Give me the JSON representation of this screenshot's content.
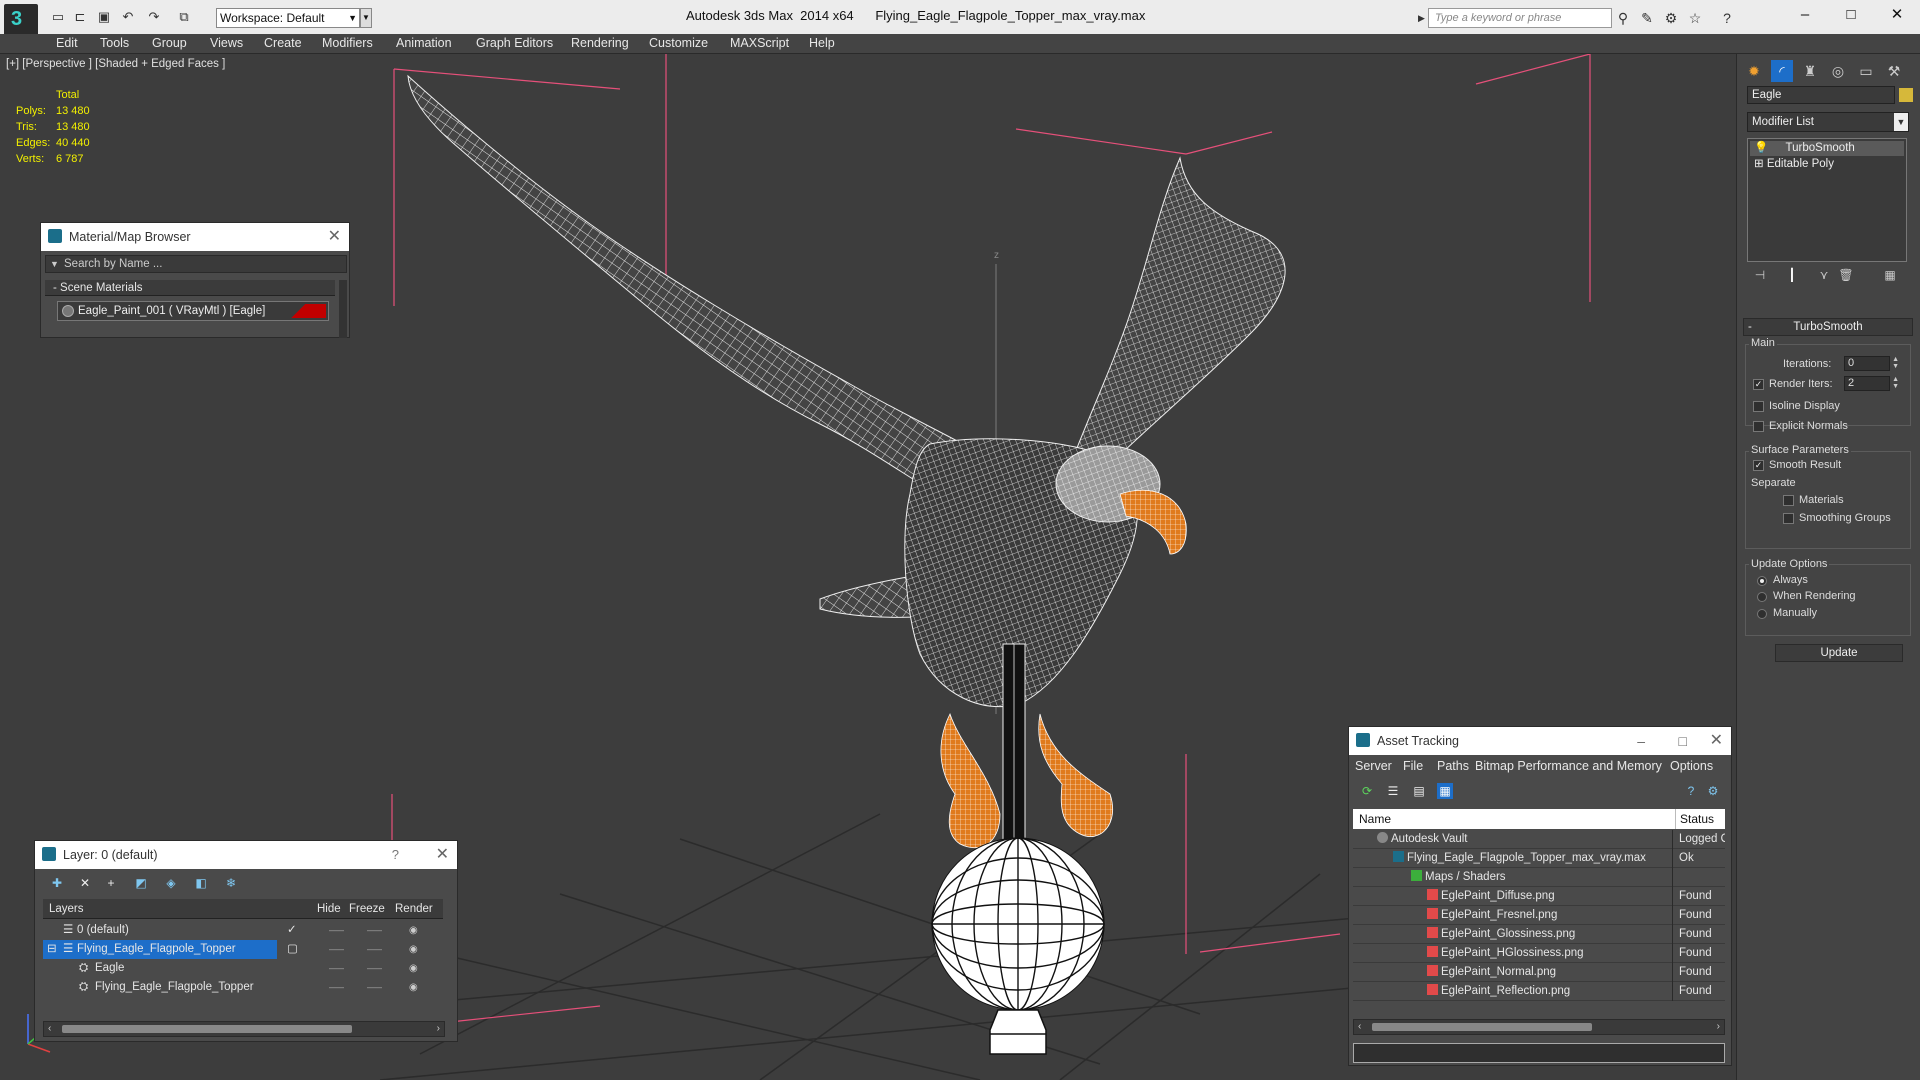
{
  "titlebar": {
    "workspace_label": "Workspace: Default",
    "app_title": "Autodesk 3ds Max  2014 x64",
    "file_title": "Flying_Eagle_Flagpole_Topper_max_vray.max",
    "search_placeholder": "Type a keyword or phrase"
  },
  "menubar": [
    "Edit",
    "Tools",
    "Group",
    "Views",
    "Create",
    "Modifiers",
    "Animation",
    "Graph Editors",
    "Rendering",
    "Customize",
    "MAXScript",
    "Help"
  ],
  "viewport": {
    "label": "[+] [Perspective ] [Shaded + Edged Faces ]",
    "stats": {
      "header": "Total",
      "rows": [
        {
          "label": "Polys:",
          "value": "13 480"
        },
        {
          "label": "Tris:",
          "value": "13 480"
        },
        {
          "label": "Edges:",
          "value": "40 440"
        },
        {
          "label": "Verts:",
          "value": "6 787"
        }
      ]
    },
    "axis_z": "z"
  },
  "material_browser": {
    "title": "Material/Map Browser",
    "search_placeholder": "Search by Name ...",
    "section": "Scene Materials",
    "section_toggle": "-",
    "item": "Eagle_Paint_001  ( VRayMtl )  [Eagle]",
    "accent": "#c10000"
  },
  "layer_panel": {
    "title": "Layer: 0 (default)",
    "help": "?",
    "columns": [
      "Layers",
      "Hide",
      "Freeze",
      "Render"
    ],
    "rows": [
      {
        "name": "0 (default)",
        "selected": false
      },
      {
        "name": "Flying_Eagle_Flagpole_Topper",
        "selected": true
      },
      {
        "name": "Eagle",
        "selected": false
      },
      {
        "name": "Flying_Eagle_Flagpole_Topper",
        "selected": false
      }
    ],
    "selection_color": "#1d6ec9"
  },
  "asset_tracking": {
    "title": "Asset Tracking",
    "menu": [
      "Server",
      "File",
      "Paths",
      "Bitmap Performance and Memory",
      "Options"
    ],
    "columns": [
      "Name",
      "Status"
    ],
    "rows": [
      {
        "name": "Autodesk Vault",
        "status": "Logged O",
        "indent": 1,
        "icon": "vault-icon"
      },
      {
        "name": "Flying_Eagle_Flagpole_Topper_max_vray.max",
        "status": "Ok",
        "indent": 2,
        "icon": "max-file-icon"
      },
      {
        "name": "Maps / Shaders",
        "status": "",
        "indent": 3,
        "icon": "maps-folder-icon"
      },
      {
        "name": "EglePaint_Diffuse.png",
        "status": "Found",
        "indent": 4,
        "icon": "png-icon"
      },
      {
        "name": "EglePaint_Fresnel.png",
        "status": "Found",
        "indent": 4,
        "icon": "png-icon"
      },
      {
        "name": "EglePaint_Glossiness.png",
        "status": "Found",
        "indent": 4,
        "icon": "png-icon"
      },
      {
        "name": "EglePaint_HGlossiness.png",
        "status": "Found",
        "indent": 4,
        "icon": "png-icon"
      },
      {
        "name": "EglePaint_Normal.png",
        "status": "Found",
        "indent": 4,
        "icon": "png-icon"
      },
      {
        "name": "EglePaint_Reflection.png",
        "status": "Found",
        "indent": 4,
        "icon": "png-icon"
      }
    ]
  },
  "command_panel": {
    "object_name": "Eagle",
    "object_color": "#d6b83a",
    "modifier_list_label": "Modifier List",
    "stack": [
      "TurboSmooth",
      "Editable Poly"
    ],
    "rollout_title": "TurboSmooth",
    "rollout_toggle": "-",
    "main_group": "Main",
    "iterations_label": "Iterations:",
    "iterations_value": "0",
    "render_iters_label": "Render Iters:",
    "render_iters_value": "2",
    "render_iters_checked": true,
    "isoline_label": "Isoline Display",
    "explicit_normals_label": "Explicit Normals",
    "surface_group": "Surface Parameters",
    "smooth_result_label": "Smooth Result",
    "separate_label": "Separate",
    "materials_label": "Materials",
    "smoothing_groups_label": "Smoothing Groups",
    "update_group": "Update Options",
    "update_always": "Always",
    "update_when_rendering": "When Rendering",
    "update_manually": "Manually",
    "update_button": "Update"
  }
}
